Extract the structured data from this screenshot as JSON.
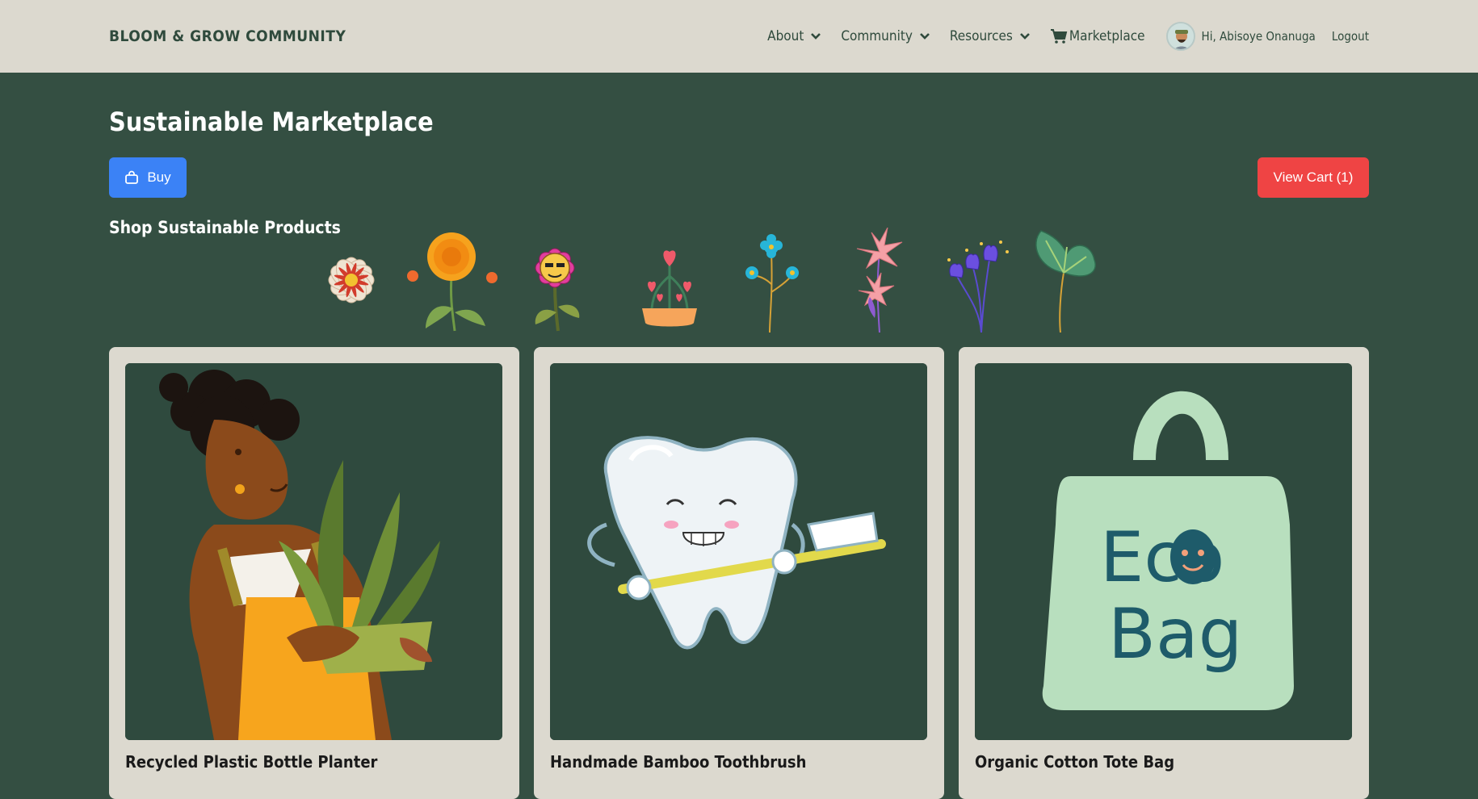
{
  "header": {
    "brand": "BLOOM & GROW COMMUNITY",
    "nav": [
      {
        "label": "About",
        "icon": "chevron-down-icon"
      },
      {
        "label": "Community",
        "icon": "chevron-down-icon"
      },
      {
        "label": "Resources",
        "icon": "chevron-down-icon"
      }
    ],
    "marketplace_label": "Marketplace",
    "user_greeting": "Hi, Abisoye Onanuga",
    "logout_label": "Logout"
  },
  "main": {
    "title": "Sustainable Marketplace",
    "buy_label": "Buy",
    "cart_label": "View Cart (1)",
    "shop_title": "Shop Sustainable Products",
    "flowers": [
      "daisy-flower",
      "orange-marigold",
      "smiling-flower",
      "heart-pot",
      "blue-flowers",
      "pink-lily",
      "purple-tulips",
      "green-leaf"
    ],
    "products": [
      {
        "name": "Recycled Plastic Bottle Planter",
        "image": "planter-illustration"
      },
      {
        "name": "Handmade Bamboo Toothbrush",
        "image": "toothbrush-illustration"
      },
      {
        "name": "Organic Cotton Tote Bag",
        "image": "tote-bag-illustration",
        "bag_text_1": "Eco",
        "bag_text_2": "Bag"
      }
    ]
  },
  "colors": {
    "background": "#344f42",
    "header": "#dcd9cf",
    "buy_button": "#3b82f6",
    "cart_button": "#ef4444"
  }
}
